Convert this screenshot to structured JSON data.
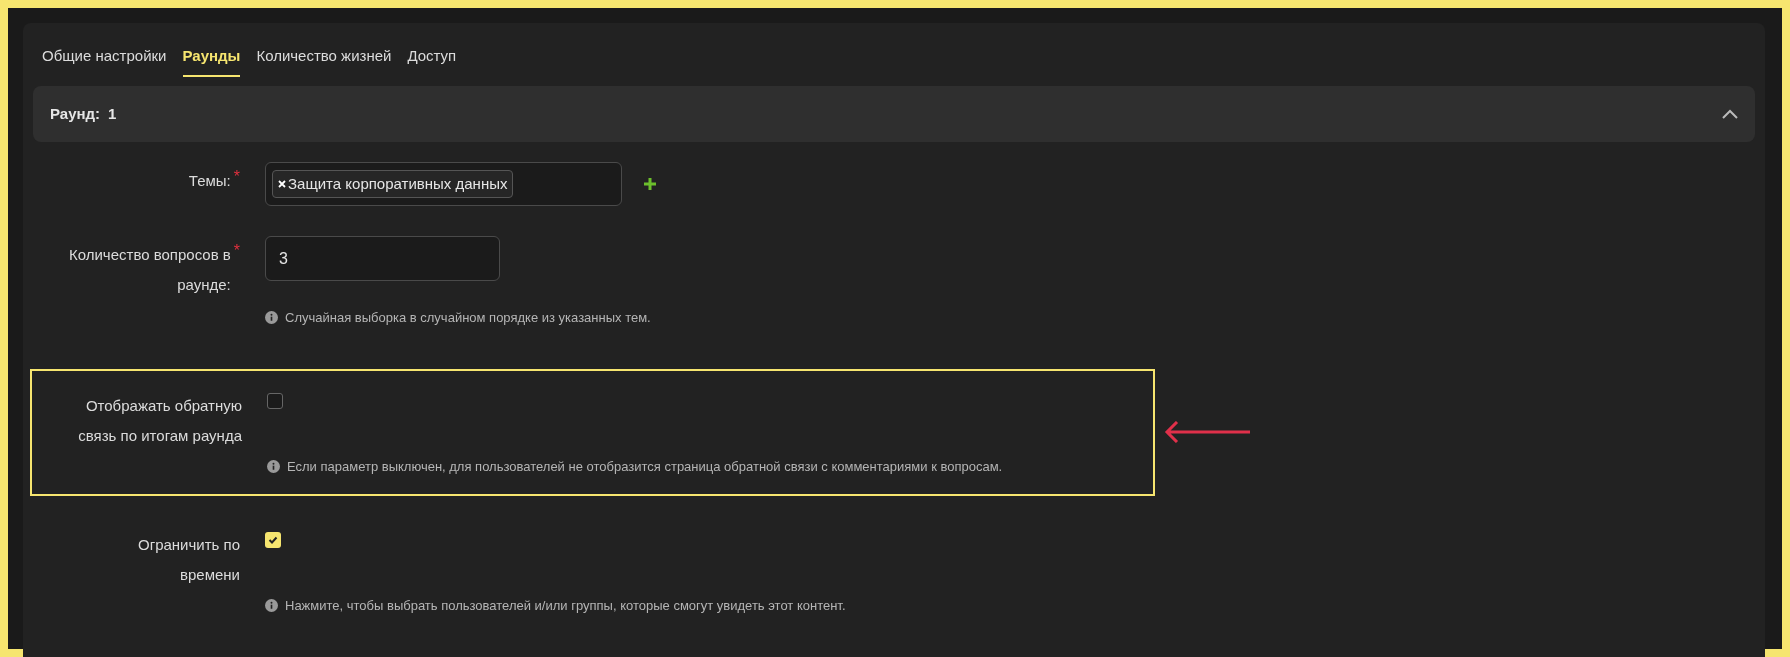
{
  "tabs": [
    {
      "label": "Общие настройки",
      "selected": false
    },
    {
      "label": "Раунды",
      "selected": true
    },
    {
      "label": "Количество жизней",
      "selected": false
    },
    {
      "label": "Доступ",
      "selected": false
    }
  ],
  "round": {
    "label": "Раунд:",
    "number": "1",
    "expanded": true
  },
  "fields": [
    {
      "kind": "tags",
      "label": "Темы:",
      "required_mark": "*",
      "highlighted": false,
      "tags": [
        "Защита корпоративных данных"
      ]
    },
    {
      "kind": "number",
      "label": "Количество вопросов в\nраунде:",
      "required_mark": "*",
      "highlighted": false,
      "value": "3",
      "hint": "Случайная выборка в случайном порядке из указанных тем."
    },
    {
      "kind": "checkbox",
      "label": "Отображать обратную\nсвязь по итогам раунда",
      "highlighted": true,
      "checked": false,
      "hint": "Если параметр выключен, для пользователей не отобразится страница обратной связи с комментариями к вопросам."
    },
    {
      "kind": "checkbox",
      "label": "Ограничить по\nвремени",
      "highlighted": false,
      "checked": true,
      "hint": "Нажмите, чтобы выбрать пользователей и/или группы, которые смогут увидеть этот контент."
    }
  ]
}
